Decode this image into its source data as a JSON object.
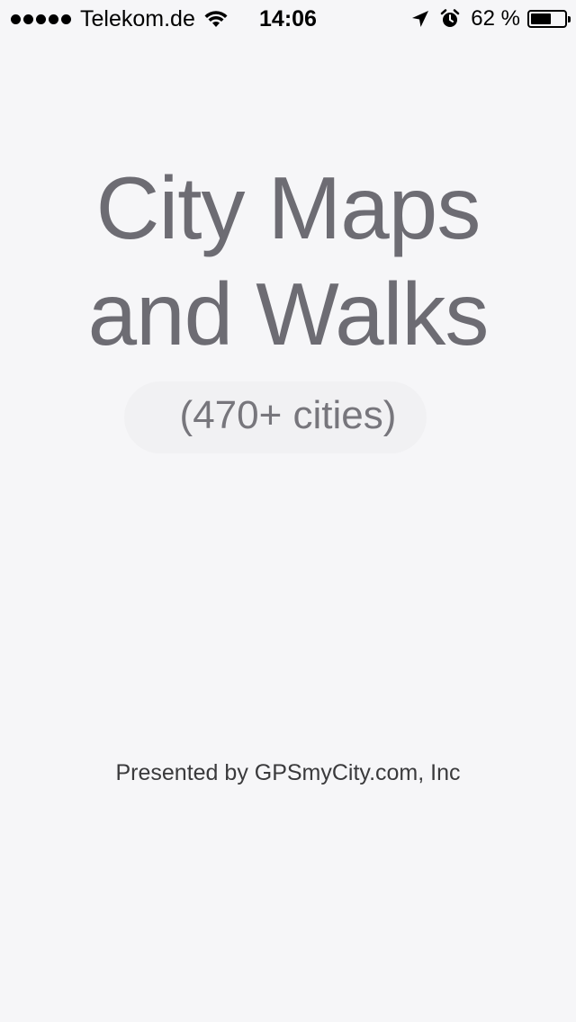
{
  "status_bar": {
    "carrier": "Telekom.de",
    "time": "14:06",
    "battery_percent_text": "62 %",
    "battery_level": 0.62,
    "icons": [
      "signal-dots",
      "wifi-icon",
      "location-arrow-icon",
      "alarm-clock-icon",
      "battery-icon"
    ]
  },
  "splash": {
    "title_line1": "City Maps",
    "title_line2": "and Walks",
    "subtitle": "(470+ cities)",
    "footer": "Presented by GPSmyCity.com, Inc"
  }
}
